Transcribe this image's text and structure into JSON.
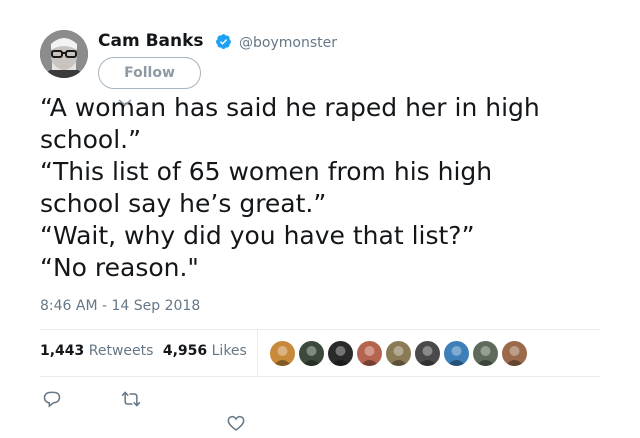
{
  "user": {
    "name": "Cam Banks",
    "handle": "@boymonster",
    "verified": true,
    "avatar_icon": "profile-photo-glasses-beard"
  },
  "follow_button": {
    "label": "Follow"
  },
  "tweet": {
    "lines": [
      "“A woman has said he raped her in high",
      "school.”",
      "“This list of 65 women from his high",
      "school say he’s great.”",
      "“Wait, why did you have that list?”",
      "“No reason.\""
    ],
    "timestamp": "8:46 AM - 14 Sep 2018"
  },
  "stats": {
    "retweets_count": "1,443",
    "retweets_label": "Retweets",
    "likes_count": "4,956",
    "likes_label": "Likes"
  },
  "likers": [
    {
      "name": "liker-avatar-1",
      "color": "#c9893a"
    },
    {
      "name": "liker-avatar-2",
      "color": "#3b4a3a"
    },
    {
      "name": "liker-avatar-3",
      "color": "#2a2a2a"
    },
    {
      "name": "liker-avatar-4",
      "color": "#b5654f"
    },
    {
      "name": "liker-avatar-5",
      "color": "#8a7a55"
    },
    {
      "name": "liker-avatar-6",
      "color": "#4a4a4a"
    },
    {
      "name": "liker-avatar-7",
      "color": "#3d7fb8"
    },
    {
      "name": "liker-avatar-8",
      "color": "#5f6a5a"
    },
    {
      "name": "liker-avatar-9",
      "color": "#9a6a4a"
    }
  ],
  "actions": [
    "reply-icon",
    "retweet-icon",
    "like-icon"
  ],
  "colors": {
    "text": "#14171a",
    "secondary": "#657786",
    "verified_blue": "#1da1f2",
    "divider": "#e6ecf0"
  }
}
